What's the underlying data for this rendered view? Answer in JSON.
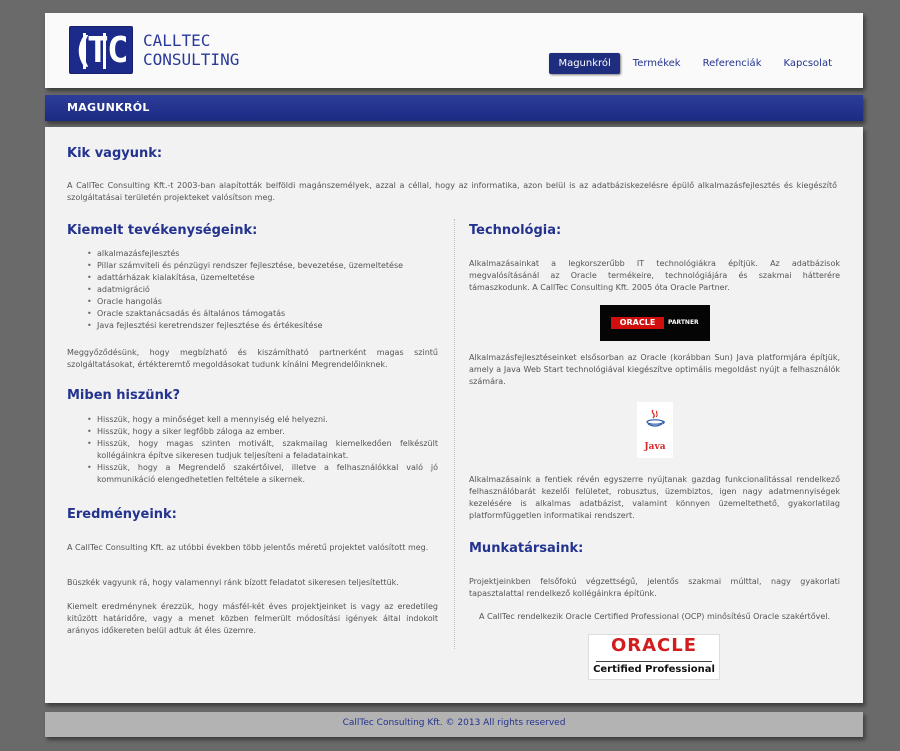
{
  "header": {
    "logo_text_line1": "CALLTEC",
    "logo_text_line2": "CONSULTING",
    "nav": [
      {
        "label": "Magunkról",
        "active": true
      },
      {
        "label": "Termékek",
        "active": false
      },
      {
        "label": "Referenciák",
        "active": false
      },
      {
        "label": "Kapcsolat",
        "active": false
      }
    ]
  },
  "section": {
    "title": "MAGUNKRÓL"
  },
  "intro": {
    "heading": "Kik vagyunk:",
    "text": "A CallTec Consulting Kft.-t 2003-ban alapították belföldi magánszemélyek, azzal a céllal, hogy az informatika, azon belül is az adatbáziskezelésre épülő alkalmazásfejlesztés és kiegészítő szolgáltatásai területén projekteket valósítson meg."
  },
  "activities": {
    "heading": "Kiemelt tevékenységeink:",
    "items": [
      "alkalmazásfejlesztés",
      "Pillar számviteli és pénzügyi rendszer fejlesztése, bevezetése, üzemeltetése",
      "adattárházak kialakítása, üzemeltetése",
      "adatmigráció",
      "Oracle hangolás",
      "Oracle szaktanácsadás és általános támogatás",
      "Java fejlesztési keretrendszer fejlesztése és értékesítése"
    ],
    "text": "Meggyőződésünk, hogy megbízható és kiszámítható partnerként magas szintű szolgáltatásokat, értékteremtő megoldásokat tudunk kínálni Megrendelőinknek."
  },
  "beliefs": {
    "heading": "Miben hiszünk?",
    "items": [
      "Hisszük, hogy a minőséget kell a mennyiség elé helyezni.",
      "Hisszük, hogy a siker legfőbb záloga az ember.",
      "Hisszük, hogy magas szinten motivált, szakmailag kiemelkedően felkészült kollégáinkra építve sikeresen tudjuk teljesíteni a feladatainkat.",
      "Hisszük, hogy a Megrendelő szakértőivel, illetve a felhasználókkal való jó kommunikáció elengedhetetlen feltétele a sikernek."
    ]
  },
  "results": {
    "heading": "Eredményeink:",
    "p1": "A CallTec Consulting Kft. az utóbbi években több jelentős méretű projektet valósított meg.",
    "p2": "Büszkék vagyunk rá, hogy valamennyi ránk bízott feladatot sikeresen teljesítettük.",
    "p3": "Kiemelt eredménynek érezzük, hogy másfél-két éves projektjeinket is vagy az eredetileg kitűzött határidőre, vagy a menet közben felmerült módosítási igények által indokolt arányos időkereten belül adtuk át éles üzemre."
  },
  "technology": {
    "heading": "Technológia:",
    "p1": "Alkalmazásainkat a legkorszerűbb IT technológiákra építjük. Az adatbázisok megvalósításánál az Oracle termékeire, technológiájára és szakmai hátterére támaszkodunk. A CallTec Consulting Kft. 2005 óta Oracle Partner.",
    "oracle_logo_word": "ORACLE",
    "oracle_partner_word": "PARTNER",
    "p2": "Alkalmazásfejlesztéseinket elsősorban az Oracle (korábban Sun) Java platformjára építjük, amely a Java Web Start technológiával kiegészítve optimális megoldást nyújt a felhasználók számára.",
    "java_word": "Java",
    "p3": "Alkalmazásaink a fentiek révén egyszerre nyújtanak gazdag funkcionalitással rendelkező felhasználóbarát kezelői felületet, robusztus, üzembiztos, igen nagy adatmennyiségek kezelésére is alkalmas adatbázist, valamint könnyen üzemeltethető, gyakorlatilag platformfüggetlen informatikai rendszert."
  },
  "staff": {
    "heading": "Munkatársaink:",
    "p1": "Projektjeinkben felsőfokú végzettségű, jelentős szakmai múlttal, nagy gyakorlati tapasztalattal rendelkező kollégáinkra építünk.",
    "p2": "A CallTec rendelkezik Oracle Certified Professional (OCP) minősítésű Oracle szakértővel.",
    "ocp_word1": "ORACLE",
    "ocp_word2": "Certified Professional"
  },
  "footer": {
    "text": "CallTec Consulting Kft. © 2013 All rights reserved"
  }
}
